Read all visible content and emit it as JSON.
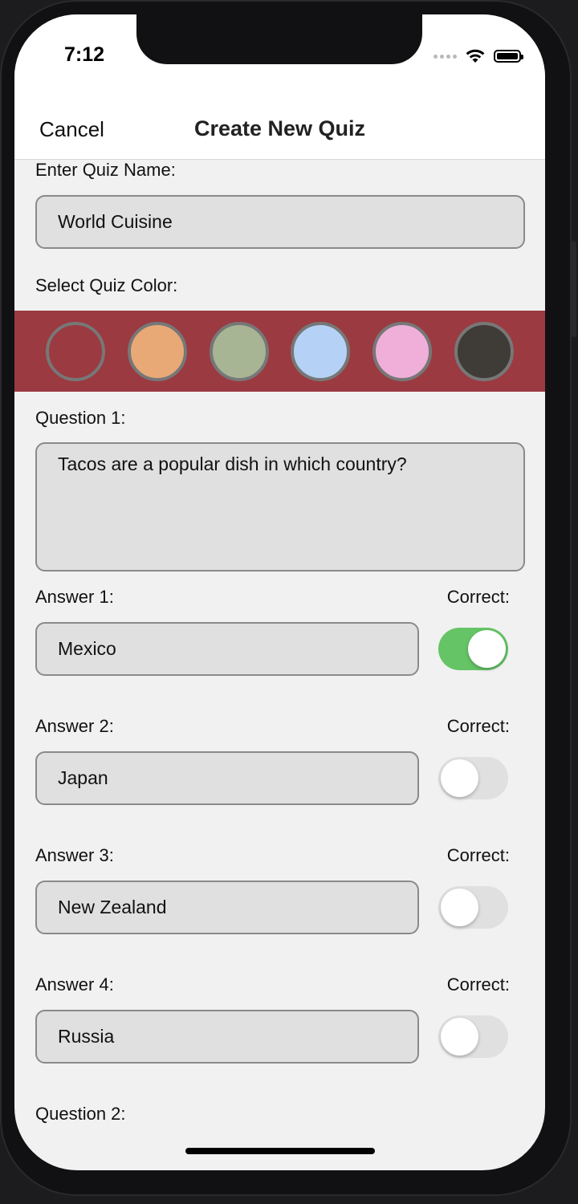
{
  "status_bar": {
    "time": "7:12"
  },
  "nav": {
    "cancel_label": "Cancel",
    "title": "Create New Quiz"
  },
  "quiz_name": {
    "label": "Enter Quiz Name:",
    "value": "World Cuisine"
  },
  "quiz_color": {
    "label": "Select Quiz Color:",
    "strip_color": "#9b3a41",
    "swatches": [
      "#9b3a41",
      "#e8a977",
      "#a7b595",
      "#b5d2f6",
      "#efafd8",
      "#3f3b36"
    ]
  },
  "question_1": {
    "label": "Question 1:",
    "text": "Tacos are a popular dish in which country?",
    "correct_label": "Correct:",
    "answers": [
      {
        "label": "Answer 1:",
        "value": "Mexico",
        "correct": true
      },
      {
        "label": "Answer 2:",
        "value": "Japan",
        "correct": false
      },
      {
        "label": "Answer 3:",
        "value": "New Zealand",
        "correct": false
      },
      {
        "label": "Answer 4:",
        "value": "Russia",
        "correct": false
      }
    ]
  },
  "question_2": {
    "label": "Question 2:"
  },
  "colors": {
    "toggle_on": "#65c466",
    "toggle_off": "#e0e0e0",
    "field_bg": "#e0e0e0"
  }
}
